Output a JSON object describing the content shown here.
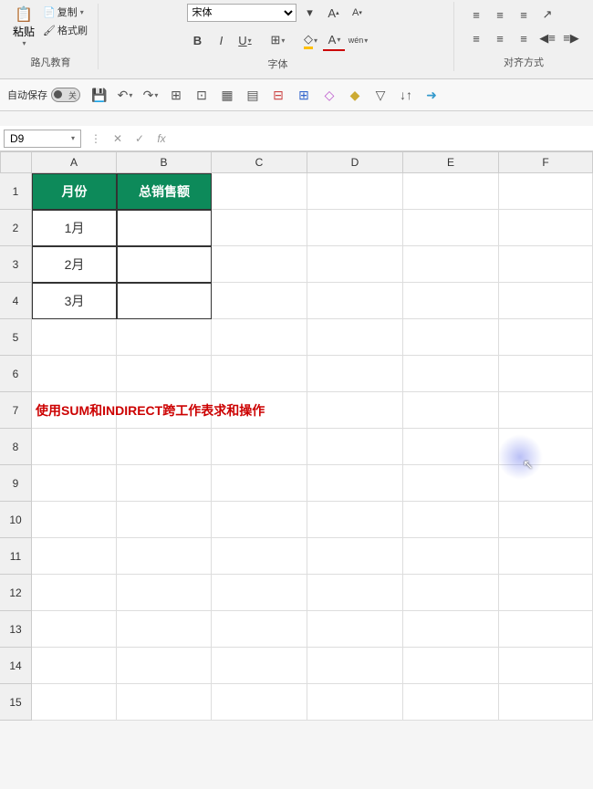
{
  "ribbon": {
    "paste_label": "粘贴",
    "copy_label": "复制",
    "format_painter_label": "格式刷",
    "clipboard_section": "路凡教育",
    "font_section": "字体",
    "align_section": "对齐方式",
    "font_name": "宋体",
    "bold": "B",
    "italic": "I",
    "underline": "U",
    "wen": "wén",
    "font_color_char": "A",
    "fill_char": "◇"
  },
  "qat": {
    "autosave_label": "自动保存",
    "autosave_state": "关"
  },
  "formula": {
    "cell_ref": "D9",
    "fx": "fx"
  },
  "cols": [
    "A",
    "B",
    "C",
    "D",
    "E",
    "F"
  ],
  "rows": [
    "1",
    "2",
    "3",
    "4",
    "5",
    "6",
    "7",
    "8",
    "9",
    "10",
    "11",
    "12",
    "13",
    "14",
    "15"
  ],
  "table": {
    "h1": "月份",
    "h2": "总销售额",
    "r1c1": "1月",
    "r2c1": "2月",
    "r3c1": "3月"
  },
  "tip": "使用SUM和INDIRECT跨工作表求和操作"
}
